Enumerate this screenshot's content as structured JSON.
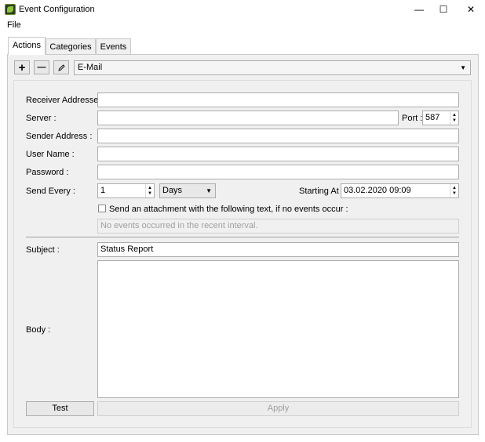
{
  "window": {
    "title": "Event Configuration",
    "controls": {
      "minimize": "—",
      "maximize": "☐",
      "close": "✕"
    }
  },
  "menu": {
    "file": "File"
  },
  "tabs": [
    {
      "label": "Actions",
      "active": true
    },
    {
      "label": "Categories",
      "active": false
    },
    {
      "label": "Events",
      "active": false
    }
  ],
  "toolbar": {
    "add": "+",
    "remove": "—",
    "edit_icon": "pencil-icon",
    "action_type": "E-Mail"
  },
  "form": {
    "receiver_label": "Receiver Addresses :",
    "receiver_value": "",
    "server_label": "Server :",
    "server_value": "",
    "port_label": "Port :",
    "port_value": "587",
    "sender_label": "Sender Address :",
    "sender_value": "",
    "username_label": "User Name :",
    "username_value": "",
    "password_label": "Password :",
    "password_value": "",
    "send_every_label": "Send Every :",
    "send_every_value": "1",
    "send_every_unit": "Days",
    "starting_at_label": "Starting At :",
    "starting_at_value": "03.02.2020 09:09",
    "attachment_label": "Send an attachment with the following text, if no events occur :",
    "attachment_checked": false,
    "attachment_text": "No events occurred in the recent interval.",
    "subject_label": "Subject :",
    "subject_value": "Status Report",
    "body_label": "Body :",
    "body_value": ""
  },
  "buttons": {
    "test": "Test",
    "apply": "Apply"
  }
}
